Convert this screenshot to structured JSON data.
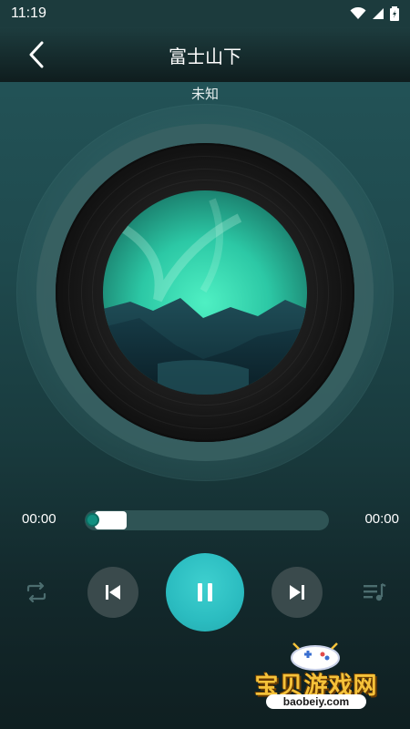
{
  "status_bar": {
    "time": "11:19"
  },
  "header": {
    "title": "富士山下"
  },
  "song": {
    "artist": "未知"
  },
  "player": {
    "elapsed": "00:00",
    "duration": "00:00",
    "buffered_fraction": 0.13,
    "progress_fraction": 0.0,
    "state": "playing"
  },
  "controls": {
    "repeat": "repeat-icon",
    "prev": "skip-previous-icon",
    "play_pause": "pause-icon",
    "next": "skip-next-icon",
    "playlist": "playlist-icon"
  },
  "watermark": {
    "line1": "宝贝游戏网",
    "line2": "baobeiy.com"
  },
  "colors": {
    "accent": "#2bbcc0",
    "knob": "#139081",
    "watermark": "#f5c23a"
  }
}
